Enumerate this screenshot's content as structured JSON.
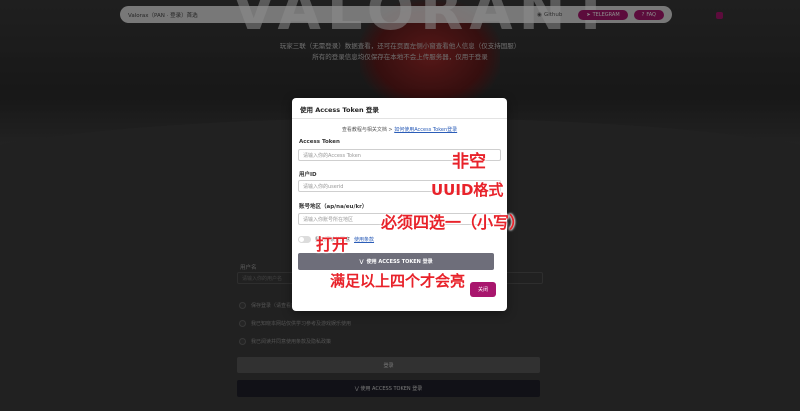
{
  "navbar": {
    "brand": "Valorax（PAN · 登录）首选",
    "github": "Github",
    "telegram": "TELEGRAM",
    "faq": "FAQ"
  },
  "hero": {
    "wordmark": "VALORANT",
    "line1": "玩家三联（无需登录）数据查看，还可在页面左侧小窗查看他人信息（仅支持国服）",
    "line2": "所有的登录信息均仅保存在本地不会上传服务器，仅用于登录"
  },
  "background_form": {
    "label": "用户名",
    "placeholder": "请输入你的用户名",
    "checks": [
      "保存登录（请查看首页说明）",
      "我已知晓本网站仅供学习参考及游戏娱乐使用",
      "我已阅读并同意使用条款及隐私政策"
    ],
    "login_label": "登录",
    "token_login_label": "使用 ACCESS TOKEN 登录"
  },
  "modal": {
    "title": "使用 Access Token 登录",
    "docs_prefix": "查看教程与相关文档 >",
    "docs_link": "如何使用Access Token登录",
    "access_token_label": "Access Token",
    "access_token_placeholder": "请输入你的Access Token",
    "userid_label": "用户ID",
    "userid_placeholder": "请输入你的userid",
    "region_label": "账号地区（ap/na/eu/kr）",
    "region_placeholder": "请输入你账号所在地区",
    "toggle_text": "我已阅读并同意",
    "toggle_link": "使用条款",
    "login_button": "使用 ACCESS TOKEN 登录",
    "close_button": "关闭"
  },
  "annotations": {
    "a1": "非空",
    "a2": "UUID格式",
    "a3": "必须四选一（小写）",
    "a4": "打开",
    "a5": "满足以上四个才会亮"
  },
  "colors": {
    "accent": "#a8166d",
    "annotation": "#e8222a"
  }
}
